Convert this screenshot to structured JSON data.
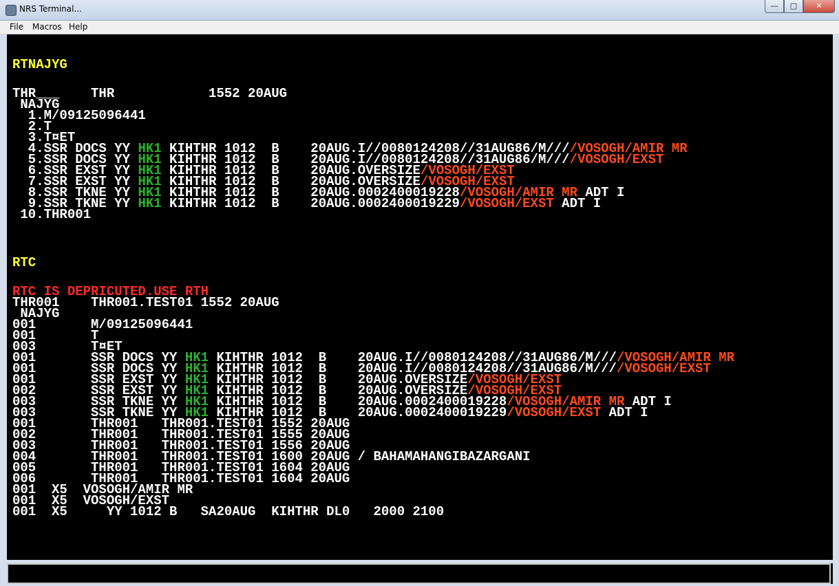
{
  "window": {
    "title": "NRS Terminal...",
    "buttons": {
      "minimize": "—",
      "maximize": "□",
      "close": "✕"
    }
  },
  "menu": [
    "File",
    "Macros",
    "Help"
  ],
  "colors": {
    "background": "#000000",
    "text": "#ffffff",
    "command": "#ffff33",
    "error": "#ff2a2a",
    "status": "#2bb12b",
    "name": "#ff4a1a"
  },
  "terminal": {
    "lines": [
      {
        "segments": [
          {
            "t": "RTNAJYG",
            "c": "yellow"
          }
        ]
      },
      {
        "segments": [
          {
            "t": "THR___    THR            1552 20AUG",
            "c": "white"
          }
        ]
      },
      {
        "segments": [
          {
            "t": " NAJYG",
            "c": "white"
          }
        ]
      },
      {
        "segments": [
          {
            "t": "  1.M/09125096441",
            "c": "white"
          }
        ]
      },
      {
        "segments": [
          {
            "t": "  2.T",
            "c": "white"
          }
        ]
      },
      {
        "segments": [
          {
            "t": "  3.T¤ET",
            "c": "white"
          }
        ]
      },
      {
        "segments": [
          {
            "t": "  4.SSR DOCS YY ",
            "c": "white"
          },
          {
            "t": "HK1",
            "c": "green"
          },
          {
            "t": " KIHTHR 1012  B    20AUG.I//0080124208//31AUG86/M///",
            "c": "white"
          },
          {
            "t": "/VOSOGH/AMIR MR",
            "c": "orange"
          }
        ]
      },
      {
        "segments": [
          {
            "t": "  5.SSR DOCS YY ",
            "c": "white"
          },
          {
            "t": "HK1",
            "c": "green"
          },
          {
            "t": " KIHTHR 1012  B    20AUG.I//0080124208//31AUG86/M///",
            "c": "white"
          },
          {
            "t": "/VOSOGH/EXST",
            "c": "orange"
          }
        ]
      },
      {
        "segments": [
          {
            "t": "  6.SSR EXST YY ",
            "c": "white"
          },
          {
            "t": "HK1",
            "c": "green"
          },
          {
            "t": " KIHTHR 1012  B    20AUG.OVERSIZE",
            "c": "white"
          },
          {
            "t": "/VOSOGH/EXST",
            "c": "orange"
          }
        ]
      },
      {
        "segments": [
          {
            "t": "  7.SSR EXST YY ",
            "c": "white"
          },
          {
            "t": "HK1",
            "c": "green"
          },
          {
            "t": " KIHTHR 1012  B    20AUG.OVERSIZE",
            "c": "white"
          },
          {
            "t": "/VOSOGH/EXST",
            "c": "orange"
          }
        ]
      },
      {
        "segments": [
          {
            "t": "  8.SSR TKNE YY ",
            "c": "white"
          },
          {
            "t": "HK1",
            "c": "green"
          },
          {
            "t": " KIHTHR 1012  B    20AUG.0002400019228",
            "c": "white"
          },
          {
            "t": "/VOSOGH/AMIR MR",
            "c": "orange"
          },
          {
            "t": " ADT I",
            "c": "white"
          }
        ]
      },
      {
        "segments": [
          {
            "t": "  9.SSR TKNE YY ",
            "c": "white"
          },
          {
            "t": "HK1",
            "c": "green"
          },
          {
            "t": " KIHTHR 1012  B    20AUG.0002400019229",
            "c": "white"
          },
          {
            "t": "/VOSOGH/EXST",
            "c": "orange"
          },
          {
            "t": " ADT I",
            "c": "white"
          }
        ]
      },
      {
        "segments": [
          {
            "t": " 10.THR001",
            "c": "white"
          }
        ]
      },
      {
        "segments": [
          {
            "t": "RTC",
            "c": "yellow"
          }
        ]
      },
      {
        "segments": [
          {
            "t": "RTC IS DEPRICUTED.USE RTH",
            "c": "red"
          }
        ]
      },
      {
        "segments": [
          {
            "t": "THR001    THR001.TEST01 1552 20AUG",
            "c": "white"
          }
        ]
      },
      {
        "segments": [
          {
            "t": " NAJYG",
            "c": "white"
          }
        ]
      },
      {
        "segments": [
          {
            "t": "001       M/09125096441",
            "c": "white"
          }
        ]
      },
      {
        "segments": [
          {
            "t": "001       T",
            "c": "white"
          }
        ]
      },
      {
        "segments": [
          {
            "t": "003       T¤ET",
            "c": "white"
          }
        ]
      },
      {
        "segments": [
          {
            "t": "001       SSR DOCS YY ",
            "c": "white"
          },
          {
            "t": "HK1",
            "c": "green"
          },
          {
            "t": " KIHTHR 1012  B    20AUG.I//0080124208//31AUG86/M///",
            "c": "white"
          },
          {
            "t": "/VOSOGH/AMIR MR",
            "c": "orange"
          }
        ]
      },
      {
        "segments": [
          {
            "t": "001       SSR DOCS YY ",
            "c": "white"
          },
          {
            "t": "HK1",
            "c": "green"
          },
          {
            "t": " KIHTHR 1012  B    20AUG.I//0080124208//31AUG86/M///",
            "c": "white"
          },
          {
            "t": "/VOSOGH/EXST",
            "c": "orange"
          }
        ]
      },
      {
        "segments": [
          {
            "t": "001       SSR EXST YY ",
            "c": "white"
          },
          {
            "t": "HK1",
            "c": "green"
          },
          {
            "t": " KIHTHR 1012  B    20AUG.OVERSIZE",
            "c": "white"
          },
          {
            "t": "/VOSOGH/EXST",
            "c": "orange"
          }
        ]
      },
      {
        "segments": [
          {
            "t": "002       SSR EXST YY ",
            "c": "white"
          },
          {
            "t": "HK1",
            "c": "green"
          },
          {
            "t": " KIHTHR 1012  B    20AUG.OVERSIZE",
            "c": "white"
          },
          {
            "t": "/VOSOGH/EXST",
            "c": "orange"
          }
        ]
      },
      {
        "segments": [
          {
            "t": "003       SSR TKNE YY ",
            "c": "white"
          },
          {
            "t": "HK1",
            "c": "green"
          },
          {
            "t": " KIHTHR 1012  B    20AUG.0002400019228",
            "c": "white"
          },
          {
            "t": "/VOSOGH/AMIR MR",
            "c": "orange"
          },
          {
            "t": " ADT I",
            "c": "white"
          }
        ]
      },
      {
        "segments": [
          {
            "t": "003       SSR TKNE YY ",
            "c": "white"
          },
          {
            "t": "HK1",
            "c": "green"
          },
          {
            "t": " KIHTHR 1012  B    20AUG.0002400019229",
            "c": "white"
          },
          {
            "t": "/VOSOGH/EXST",
            "c": "orange"
          },
          {
            "t": " ADT I",
            "c": "white"
          }
        ]
      },
      {
        "segments": [
          {
            "t": "001       THR001   THR001.TEST01 1552 20AUG",
            "c": "white"
          }
        ]
      },
      {
        "segments": [
          {
            "t": "002       THR001   THR001.TEST01 1555 20AUG",
            "c": "white"
          }
        ]
      },
      {
        "segments": [
          {
            "t": "003       THR001   THR001.TEST01 1556 20AUG",
            "c": "white"
          }
        ]
      },
      {
        "segments": [
          {
            "t": "004       THR001   THR001.TEST01 1600 20AUG / BAHAMAHANGIBAZARGANI",
            "c": "white"
          }
        ]
      },
      {
        "segments": [
          {
            "t": "005       THR001   THR001.TEST01 1604 20AUG",
            "c": "white"
          }
        ]
      },
      {
        "segments": [
          {
            "t": "006       THR001   THR001.TEST01 1604 20AUG",
            "c": "white"
          }
        ]
      },
      {
        "segments": [
          {
            "t": "001  X5  VOSOGH/AMIR MR",
            "c": "white"
          }
        ]
      },
      {
        "segments": [
          {
            "t": "001  X5  VOSOGH/EXST",
            "c": "white"
          }
        ]
      },
      {
        "segments": [
          {
            "t": "001  X5     YY 1012 B   SA20AUG  KIHTHR DL0   2000 2100",
            "c": "white"
          }
        ]
      }
    ]
  },
  "input": {
    "value": ""
  }
}
